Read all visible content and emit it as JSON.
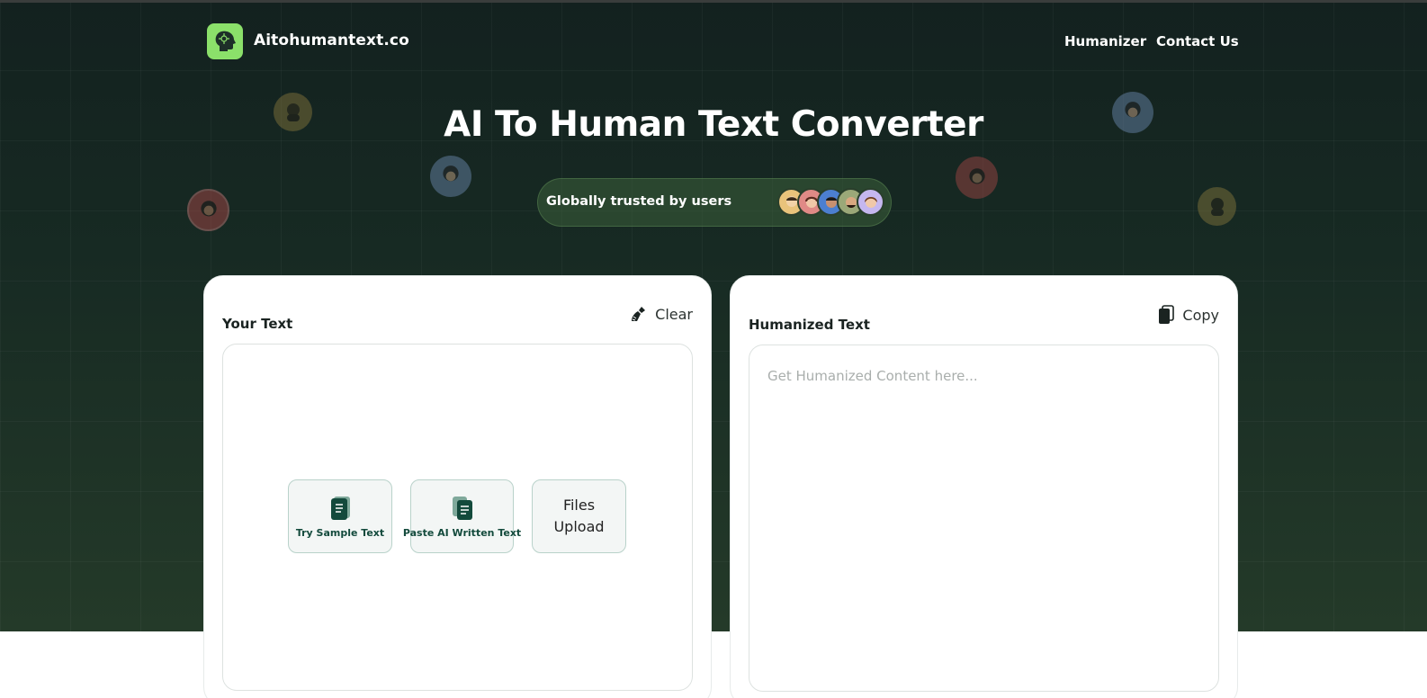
{
  "header": {
    "brand": "Aitohumantext.co",
    "logo_icon": "ai-head-icon",
    "nav": [
      {
        "label": "Humanizer"
      },
      {
        "label": "Contact Us"
      }
    ]
  },
  "hero": {
    "title": "AI To Human Text Converter",
    "trust_label": "Globally trusted by users",
    "trust_avatar_colors": [
      "#e9c37b",
      "#e08a86",
      "#4c7fd0",
      "#9ba878",
      "#c5b7ef"
    ]
  },
  "input_panel": {
    "label": "Your Text",
    "clear_label": "Clear",
    "clear_icon": "broom-icon",
    "options": {
      "sample": {
        "label": "Try Sample Text",
        "icon": "document-icon"
      },
      "paste": {
        "label": "Paste AI Written Text",
        "icon": "paste-document-icon"
      },
      "files_line1": "Files",
      "files_line2": "Upload"
    }
  },
  "output_panel": {
    "label": "Humanized Text",
    "copy_label": "Copy",
    "copy_icon": "copy-icon",
    "placeholder": "Get Humanized Content here..."
  },
  "colors": {
    "accent_green": "#8be06a",
    "dark_green": "#134a3c",
    "hero_bg": "#13211f"
  }
}
